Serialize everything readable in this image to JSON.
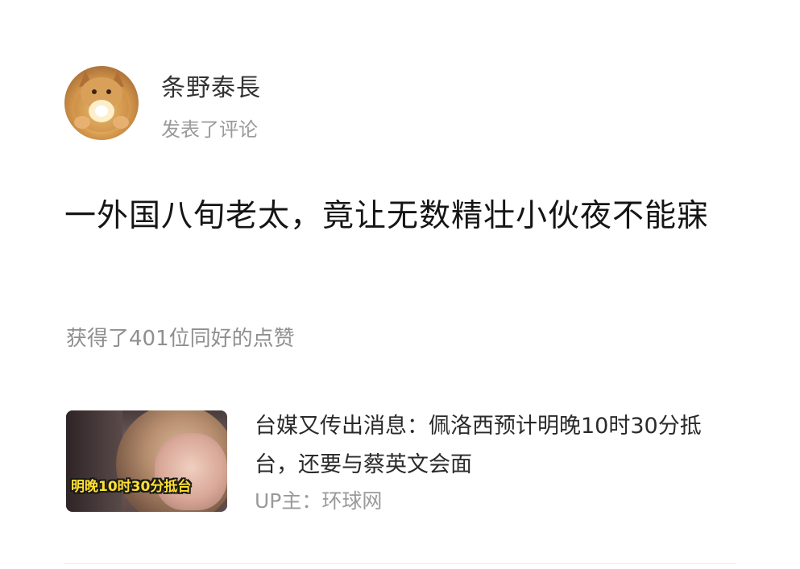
{
  "author": {
    "name": "条野泰長",
    "action": "发表了评论"
  },
  "comment": {
    "text": "一外国八旬老太，竟让无数精壮小伙夜不能寐"
  },
  "likes": {
    "text": "获得了401位同好的点赞"
  },
  "video": {
    "thumbnail_caption": "明晚10时30分抵台",
    "title": "台媒又传出消息：佩洛西预计明晚10时30分抵台，还要与蔡英文会面",
    "uploader": "UP主：环球网"
  },
  "colors": {
    "text_primary": "#151515",
    "text_secondary": "#9a9a9a",
    "caption_yellow": "#ffe033",
    "background": "#ffffff"
  }
}
